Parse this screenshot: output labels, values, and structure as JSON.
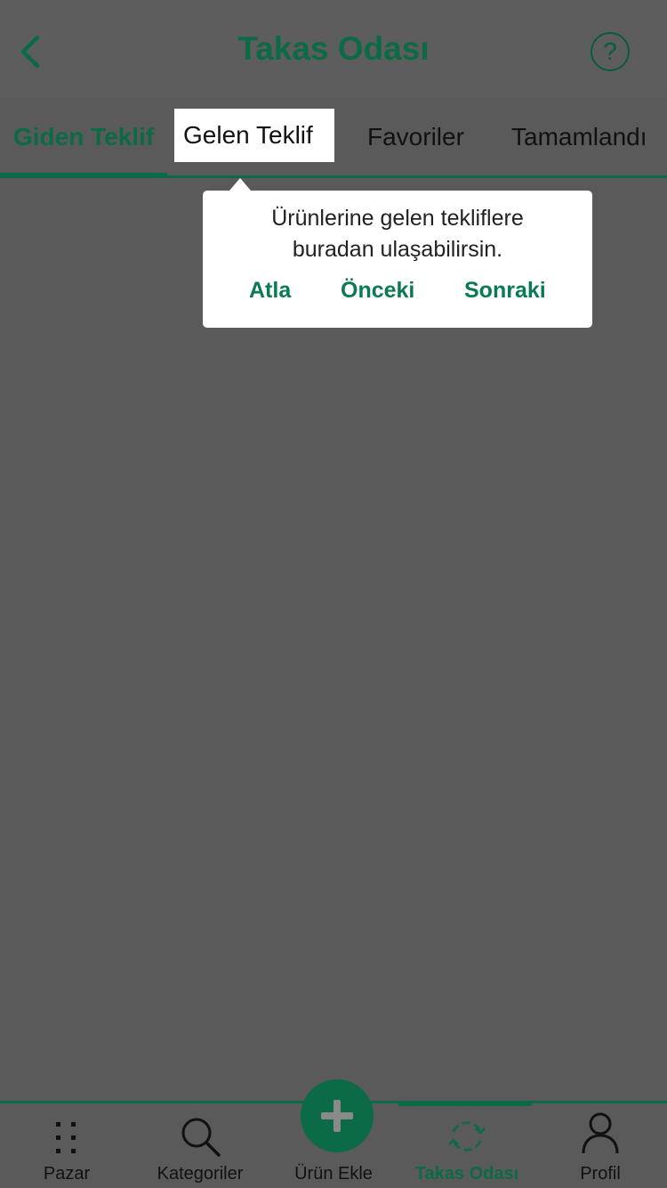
{
  "header": {
    "title": "Takas Odası",
    "back_icon": "chevron-left-icon",
    "help_icon": "question-circle-icon",
    "help_glyph": "?"
  },
  "tabs": [
    {
      "label": "Giden Teklif",
      "active": true
    },
    {
      "label": "Gelen Teklif",
      "active": false,
      "highlighted": true
    },
    {
      "label": "Favoriler",
      "active": false
    },
    {
      "label": "Tamamlandı",
      "active": false
    }
  ],
  "tooltip": {
    "line1": "Ürünlerine gelen tekliflere",
    "line2": "buradan ulaşabilirsin.",
    "skip_label": "Atla",
    "prev_label": "Önceki",
    "next_label": "Sonraki"
  },
  "bottom_nav": [
    {
      "label": "Pazar",
      "icon": "grid-dots-icon"
    },
    {
      "label": "Kategoriler",
      "icon": "search-icon"
    },
    {
      "label": "Ürün Ekle",
      "icon": "plus-icon"
    },
    {
      "label": "Takas Odası",
      "icon": "swap-cycle-icon",
      "active": true
    },
    {
      "label": "Profil",
      "icon": "user-icon"
    }
  ],
  "colors": {
    "accent": "#0b6b46",
    "overlay": "#5a5a5a"
  }
}
